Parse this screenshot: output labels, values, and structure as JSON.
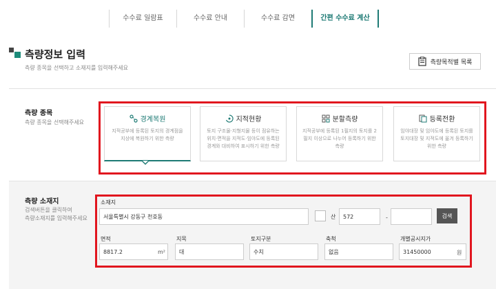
{
  "tabs": [
    {
      "label": "수수료 일람표"
    },
    {
      "label": "수수료 안내"
    },
    {
      "label": "수수료 감면"
    },
    {
      "label": "간편 수수료 계산"
    }
  ],
  "header": {
    "title": "측량정보 입력",
    "subtitle": "측량 종목을 선택하고 소재지를 입력해주세요",
    "list_button": "측량목적별 목록"
  },
  "survey_type": {
    "label": "측량 종목",
    "desc": "측량 종목을 선택해주세요",
    "cards": [
      {
        "title": "경계복원",
        "desc": "지적공부에 등록된 토지의 경계점을 지상에 복원하기 위한 측량"
      },
      {
        "title": "지적현황",
        "desc": "토지 구조물·지형지물 등이 점유하는 위치·면적을 지적도·임야도에 등록된 경계와 대비하여 표시하기 위한 측량"
      },
      {
        "title": "분할측량",
        "desc": "지적공부에 등록된 1필지의 토지를 2필지 이상으로 나누어 등록하기 위한 측량"
      },
      {
        "title": "등록전환",
        "desc": "임야대장 및 임야도에 등록된 토지를 토지대장 및 지적도에 옮겨 등록하기 위한 측량"
      }
    ]
  },
  "location": {
    "label": "측량 소재지",
    "desc1": "검색버튼을 클릭하여",
    "desc2": "측량소재지를 입력해주세요",
    "address_label": "소재지",
    "address_value": "서울특별시 강동구 천호동",
    "mountain_label": "산",
    "lot_main": "572",
    "dash": "-",
    "lot_sub": "",
    "search_button": "검색"
  },
  "fields": [
    {
      "label": "면적",
      "value": "8817.2",
      "unit": "m²"
    },
    {
      "label": "지목",
      "value": "대",
      "unit": ""
    },
    {
      "label": "토지구분",
      "value": "수치",
      "unit": ""
    },
    {
      "label": "축척",
      "value": "없음",
      "unit": ""
    },
    {
      "label": "개별공시지가",
      "value": "31450000",
      "unit": "원"
    }
  ],
  "colors": {
    "accent": "#1d7a74",
    "highlight": "#e1151e"
  }
}
